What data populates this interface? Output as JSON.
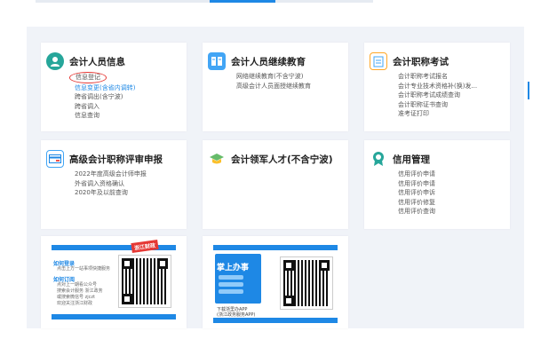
{
  "cards": [
    {
      "title": "会计人员信息",
      "icon": "person-info-icon",
      "links": [
        "信息登记",
        "信息变更(含省内调转)",
        "跨省调出(含宁波)",
        "跨省调入",
        "信息查询"
      ]
    },
    {
      "title": "会计人员继续教育",
      "icon": "book-icon",
      "links": [
        "网络继续教育(不含宁波)",
        "高级会计人员面授继续教育"
      ]
    },
    {
      "title": "会计职称考试",
      "icon": "clipboard-icon",
      "links": [
        "会计职称考试报名",
        "会计专业技术资格补(换)发...",
        "会计职称考试成绩查询",
        "会计职称证书查询",
        "准考证打印"
      ]
    },
    {
      "title": "高级会计职称评审申报",
      "icon": "card-icon",
      "links": [
        "2022年度高级会计师申报",
        "外省调入资格确认",
        "2020年及以前查询"
      ]
    },
    {
      "title": "会计领军人才(不含宁波)",
      "icon": "graduation-cap-icon",
      "links": []
    },
    {
      "title": "信用管理",
      "icon": "medal-icon",
      "links": [
        "信用评价申请",
        "信用评价申请",
        "信用评价申诉",
        "信用评价修复",
        "信用评价查询"
      ]
    }
  ],
  "promo1": {
    "badge": "浙江财政",
    "label1": "如何登录",
    "label2": "如何订阅",
    "text1": "点击上方一站事项快捷服务",
    "text2": "点对上一期看公众号",
    "text3": "搜索会计服务 浙江政务",
    "text4": "或搜索微信号 zjczt",
    "text5": "欢迎关注浙江财政"
  },
  "promo2": {
    "app_title": "掌上办事",
    "caption1": "下载浙里办APP",
    "caption2": "(浙江政务服务APP)"
  },
  "colors": {
    "accent": "#1e88e5",
    "highlight_circle": "#e53935"
  }
}
